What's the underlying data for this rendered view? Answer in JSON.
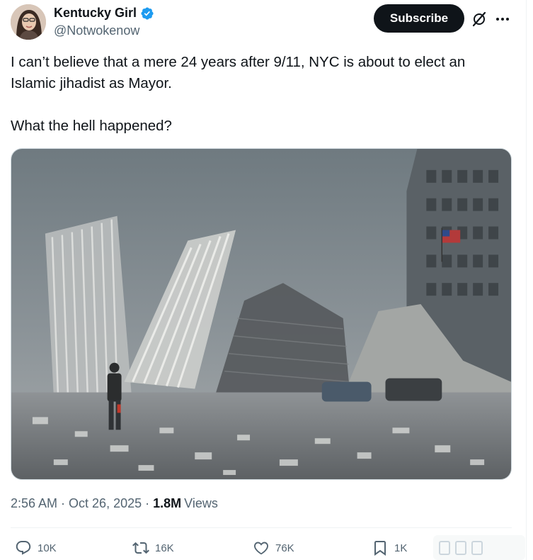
{
  "author": {
    "display_name": "Kentucky Girl",
    "handle": "@Notwokenow",
    "verified_color": "#1d9bf0"
  },
  "header": {
    "subscribe_label": "Subscribe",
    "grok_icon": "grok-slash-icon",
    "more_icon": "more-horizontal-icon"
  },
  "tweet": {
    "paragraph_1": "I can’t believe that a mere 24 years after 9/11, NYC is about to elect an Islamic jihadist as Mayor.",
    "paragraph_2": "What the hell happened?"
  },
  "meta": {
    "time": "2:56 AM",
    "date": "Oct 26, 2025",
    "separator": "·",
    "views_count": "1.8M",
    "views_label": "Views"
  },
  "actions": {
    "replies": "10K",
    "reposts": "16K",
    "likes": "76K",
    "bookmarks": "1K"
  },
  "colors": {
    "text_primary": "#0f1419",
    "text_secondary": "#536471",
    "button_dark": "#0f1419",
    "border": "#eff3f4"
  }
}
